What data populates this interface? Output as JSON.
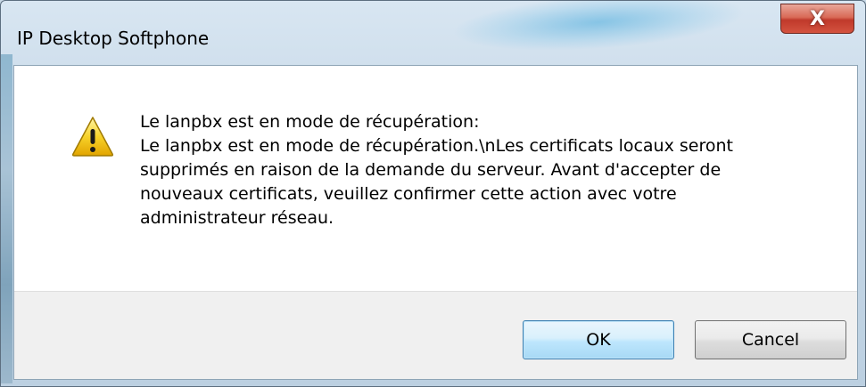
{
  "window": {
    "title": "IP Desktop Softphone",
    "close_label": "X"
  },
  "dialog": {
    "icon": "warning-icon",
    "message_lines": [
      "Le lanpbx est en mode de récupération:",
      "Le lanpbx est en mode de récupération.\\nLes certificats locaux seront",
      "supprimés en raison de la demande du serveur. Avant d'accepter de",
      "nouveaux certificats, veuillez confirmer cette action avec votre",
      "administrateur réseau."
    ]
  },
  "buttons": {
    "ok_label": "OK",
    "cancel_label": "Cancel"
  },
  "colors": {
    "close_red": "#c0392b",
    "ok_blue": "#bee6fd",
    "footer_gray": "#f0f0f0",
    "warning_yellow": "#f5c400"
  }
}
